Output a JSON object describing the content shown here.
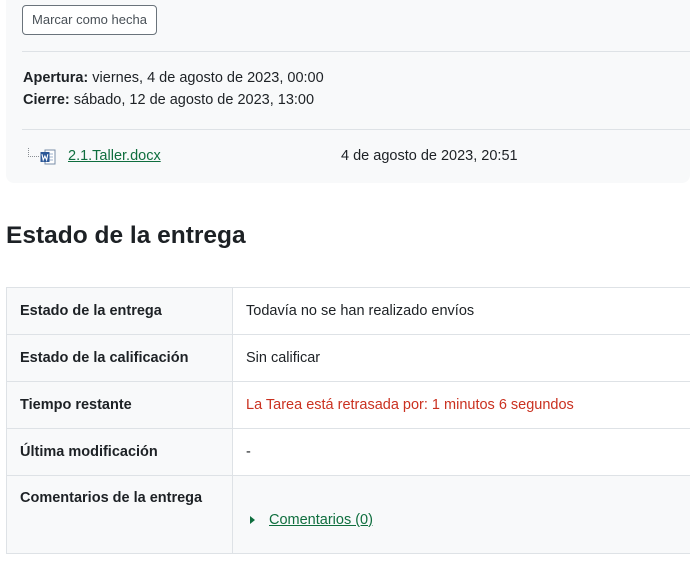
{
  "activity": {
    "mark_done_label": "Marcar como hecha",
    "opening_label": "Apertura:",
    "opening_value": " viernes, 4 de agosto de 2023, 00:00",
    "closing_label": "Cierre:",
    "closing_value": " sábado, 12 de agosto de 2023, 13:00",
    "file": {
      "icon": "word-document-icon",
      "name": "2.1.Taller.docx",
      "date": "4 de agosto de 2023, 20:51"
    }
  },
  "submission": {
    "title": "Estado de la entrega",
    "rows": [
      {
        "label": "Estado de la entrega",
        "value": "Todavía no se han realizado envíos"
      },
      {
        "label": "Estado de la calificación",
        "value": "Sin calificar"
      },
      {
        "label": "Tiempo restante",
        "value": "La Tarea está retrasada por: 1 minutos 6 segundos"
      },
      {
        "label": "Última modificación",
        "value": "-"
      },
      {
        "label": "Comentarios de la entrega",
        "value": "Comentarios (0)"
      }
    ]
  },
  "colors": {
    "link": "#0f6e3e",
    "overdue": "#ca3120",
    "panel_bg": "#f8f9fa"
  }
}
